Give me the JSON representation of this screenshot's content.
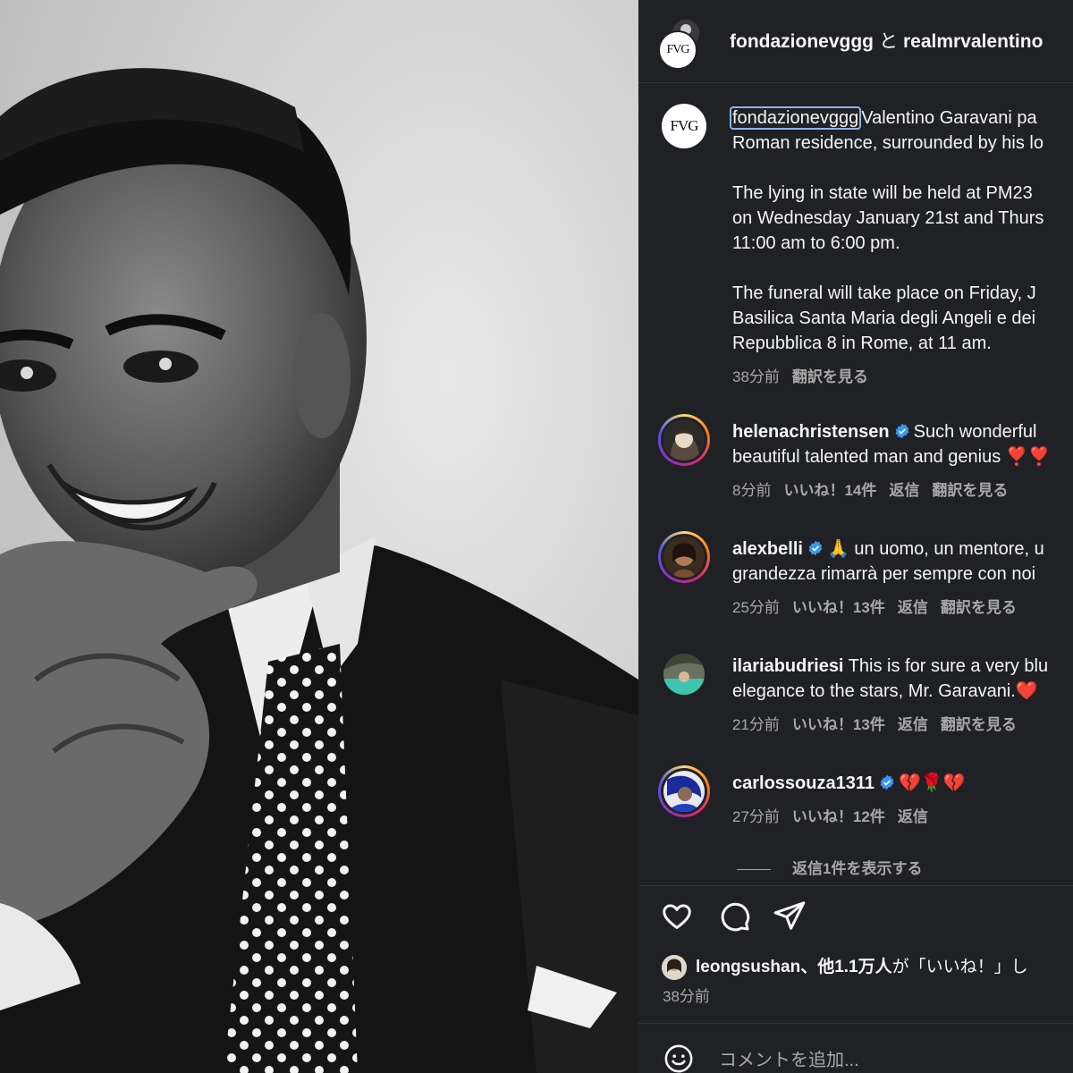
{
  "header": {
    "account_1": "fondazionevggg",
    "joiner": "と",
    "account_2": "realmrvalentino"
  },
  "logo_text": "FVG",
  "caption": {
    "username": "fondazionevggg",
    "lines": [
      "Valentino Garavani pa",
      "Roman residence, surrounded by his lo",
      "The lying in state will be held at PM23",
      "on Wednesday January 21st and Thurs",
      "11:00 am to 6:00 pm.",
      "The funeral will take place on Friday, J",
      "Basilica Santa Maria degli Angeli e dei",
      "Repubblica 8 in Rome, at 11 am."
    ],
    "time": "38分前",
    "translate": "翻訳を見る"
  },
  "comments": [
    {
      "username": "helenachristensen",
      "verified": true,
      "line1": "Such wonderful",
      "line2": "beautiful talented man and genius ❣️❣️",
      "time": "8分前",
      "likes": "いいね！14件",
      "reply": "返信",
      "translate": "翻訳を見る"
    },
    {
      "username": "alexbelli",
      "verified": true,
      "line1": "🙏 un uomo, un mentore, u",
      "line2": "grandezza rimarrà per sempre con noi",
      "time": "25分前",
      "likes": "いいね！13件",
      "reply": "返信",
      "translate": "翻訳を見る"
    },
    {
      "username": "ilariabudriesi",
      "verified": false,
      "line1": "This is for sure a very blu",
      "line2": "elegance to the stars, Mr. Garavani.❤️",
      "time": "21分前",
      "likes": "いいね！13件",
      "reply": "返信",
      "translate": "翻訳を見る"
    },
    {
      "username": "carlossouza1311",
      "verified": true,
      "line1": "💔🌹💔",
      "line2": "",
      "time": "27分前",
      "likes": "いいね！12件",
      "reply": "返信",
      "translate": ""
    }
  ],
  "view_replies": "返信1件を表示する",
  "actions": {
    "like_icon": "heart-icon",
    "comment_icon": "comment-icon",
    "share_icon": "share-icon"
  },
  "likes_summary": {
    "user": "leongsushan",
    "rest": "、他1.1万人",
    "suffix": "が「いいね！」し"
  },
  "post_time": "38分前",
  "comment_input": {
    "placeholder": "コメントを追加..."
  },
  "colors": {
    "background": "#202125",
    "verified": "#3897f0",
    "muted": "#a8a8a8"
  }
}
